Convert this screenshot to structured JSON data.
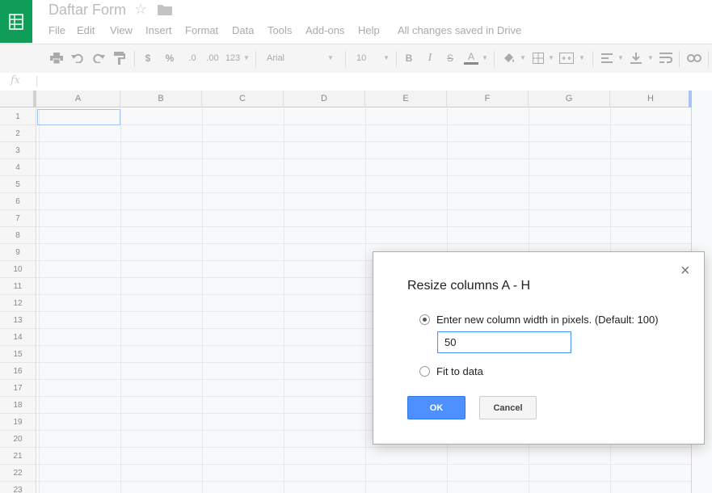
{
  "header": {
    "title": "Daftar Form",
    "star_icon": "star-icon",
    "folder_icon": "folder-icon",
    "logo_icon": "sheets-logo-icon",
    "brand_color": "#0f9d58"
  },
  "menu": {
    "file": "File",
    "edit": "Edit",
    "view": "View",
    "insert": "Insert",
    "format": "Format",
    "data": "Data",
    "tools": "Tools",
    "addons": "Add-ons",
    "help": "Help",
    "save_status": "All changes saved in Drive"
  },
  "toolbar": {
    "currency": "$",
    "percent": "%",
    "decrease_decimals": ".0",
    "increase_decimals": ".00",
    "more_formats": "123",
    "font": "Arial",
    "font_size": "10",
    "bold": "B",
    "italic": "I",
    "strikethrough": "S",
    "text_color": "A",
    "icons": [
      "print-icon",
      "undo-icon",
      "redo-icon",
      "paint-format-icon",
      "fill-color-icon",
      "borders-icon",
      "merge-cells-icon",
      "align-icon",
      "valign-icon",
      "wrap-icon",
      "link-icon"
    ]
  },
  "formula_bar": {
    "fx_label": "fx",
    "value": ""
  },
  "grid": {
    "columns": [
      "A",
      "B",
      "C",
      "D",
      "E",
      "F",
      "G",
      "H"
    ],
    "rows": [
      "1",
      "2",
      "3",
      "4",
      "5",
      "6",
      "7",
      "8",
      "9",
      "10",
      "11",
      "12",
      "13",
      "14",
      "15",
      "16",
      "17",
      "18",
      "19",
      "20",
      "21",
      "22",
      "23"
    ],
    "active_cell": "A1"
  },
  "dialog": {
    "title": "Resize columns A - H",
    "close": "×",
    "option_pixels_label": "Enter new column width in pixels. (Default: 100)",
    "input_value": "50",
    "option_fit_label": "Fit to data",
    "selected_option": "pixels",
    "ok_label": "OK",
    "cancel_label": "Cancel",
    "accent_color": "#4d90fe"
  }
}
